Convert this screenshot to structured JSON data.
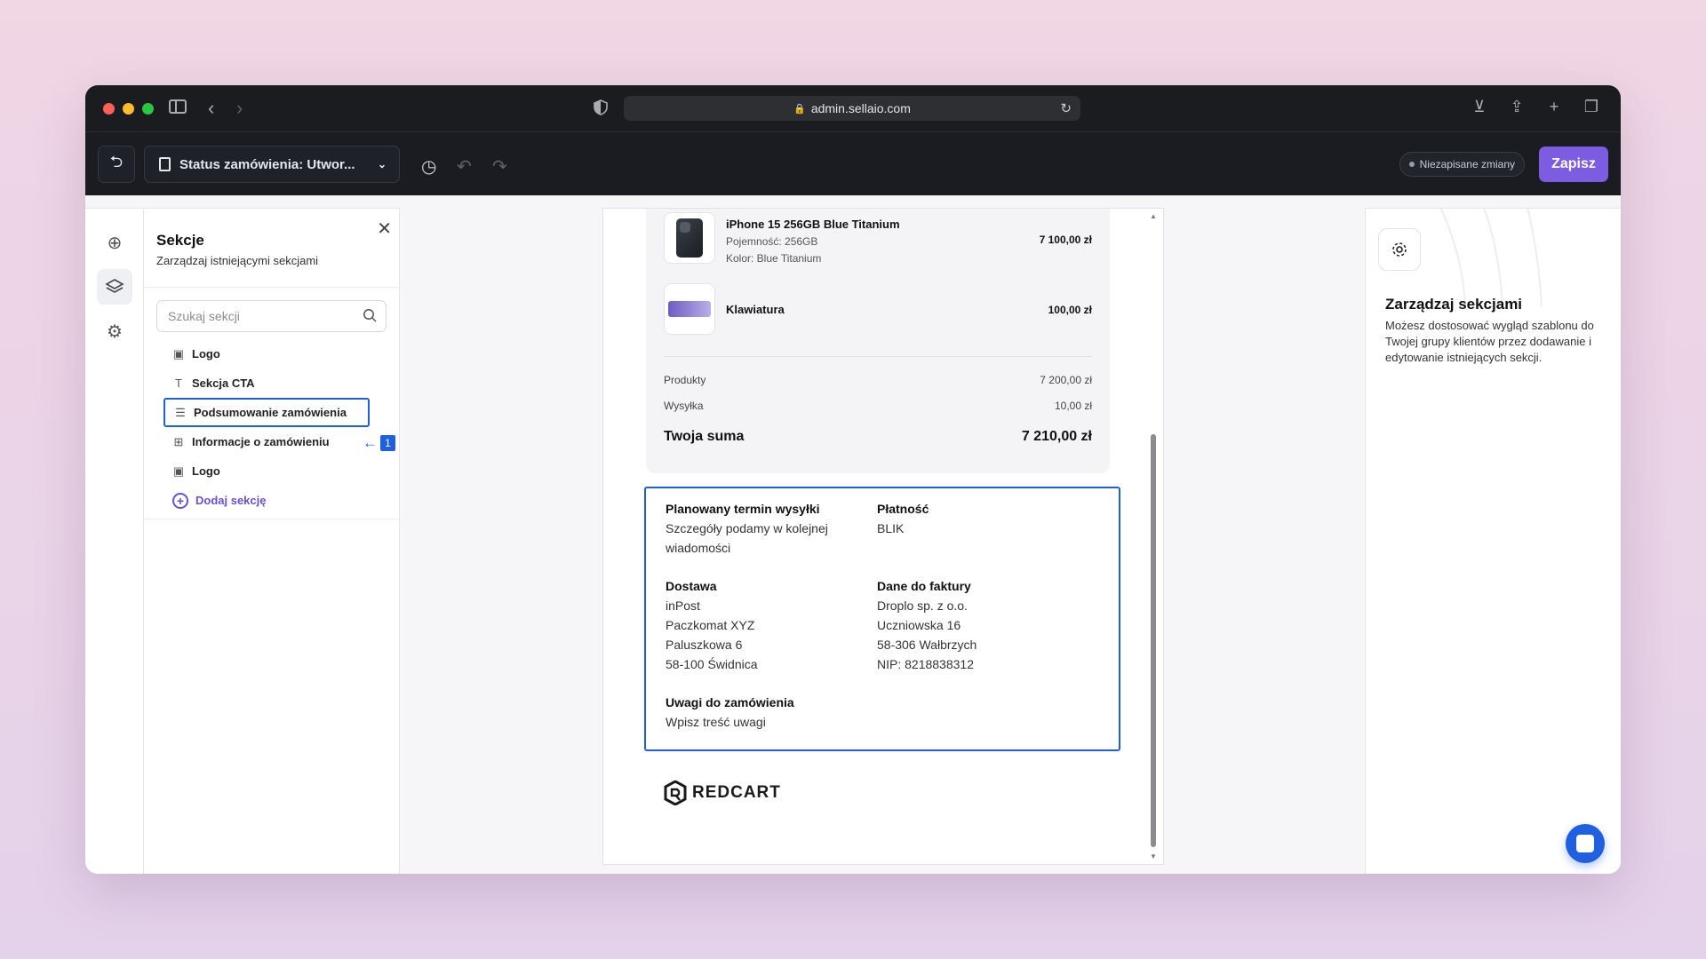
{
  "browser": {
    "url": "admin.sellaio.com"
  },
  "toolbar": {
    "document_title": "Status zamówienia: Utwor...",
    "unsaved_label": "Niezapisane zmiany",
    "save_label": "Zapisz"
  },
  "sections_panel": {
    "title": "Sekcje",
    "subtitle": "Zarządzaj istniejącymi sekcjami",
    "search_placeholder": "Szukaj sekcji",
    "items": [
      {
        "label": "Logo",
        "icon": "image-icon"
      },
      {
        "label": "Sekcja CTA",
        "icon": "text-icon"
      },
      {
        "label": "Podsumowanie zamówienia",
        "icon": "list-icon",
        "selected": true
      },
      {
        "label": "Informacje o zamówieniu",
        "icon": "table-icon"
      },
      {
        "label": "Logo",
        "icon": "image-icon"
      }
    ],
    "add_label": "Dodaj sekcję",
    "annotation_number": "1"
  },
  "order_summary": {
    "products": [
      {
        "name": "iPhone 15 256GB Blue Titanium",
        "attr1": "Pojemność: 256GB",
        "attr2": "Kolor: Blue Titanium",
        "price": "7 100,00 zł"
      },
      {
        "name": "Klawiatura",
        "price": "100,00 zł"
      }
    ],
    "products_label": "Produkty",
    "products_value": "7 200,00 zł",
    "shipping_label": "Wysyłka",
    "shipping_value": "10,00 zł",
    "total_label": "Twoja suma",
    "total_value": "7 210,00 zł"
  },
  "order_info": {
    "shipping_date_title": "Planowany termin wysyłki",
    "shipping_date_line1": "Szczegóły podamy w kolejnej",
    "shipping_date_line2": "wiadomości",
    "payment_title": "Płatność",
    "payment_value": "BLIK",
    "delivery_title": "Dostawa",
    "delivery_lines": [
      "inPost",
      "Paczkomat XYZ",
      "Paluszkowa 6",
      "58-100 Świdnica"
    ],
    "invoice_title": "Dane do faktury",
    "invoice_lines": [
      "Droplo sp. z o.o.",
      "Uczniowska 16",
      "58-306 Wałbrzych",
      "NIP: 8218838312"
    ],
    "notes_title": "Uwagi do zamówienia",
    "notes_value": "Wpisz treść uwagi"
  },
  "brand": {
    "name": "REDCART"
  },
  "right_panel": {
    "title": "Zarządzaj sekcjami",
    "description": "Możesz dostosować wygląd szablonu do Twojej grupy klientów przez dodawanie i edytowanie istniejących sekcji."
  },
  "colors": {
    "accent": "#7c5ce0",
    "selection": "#1f5fe0"
  }
}
